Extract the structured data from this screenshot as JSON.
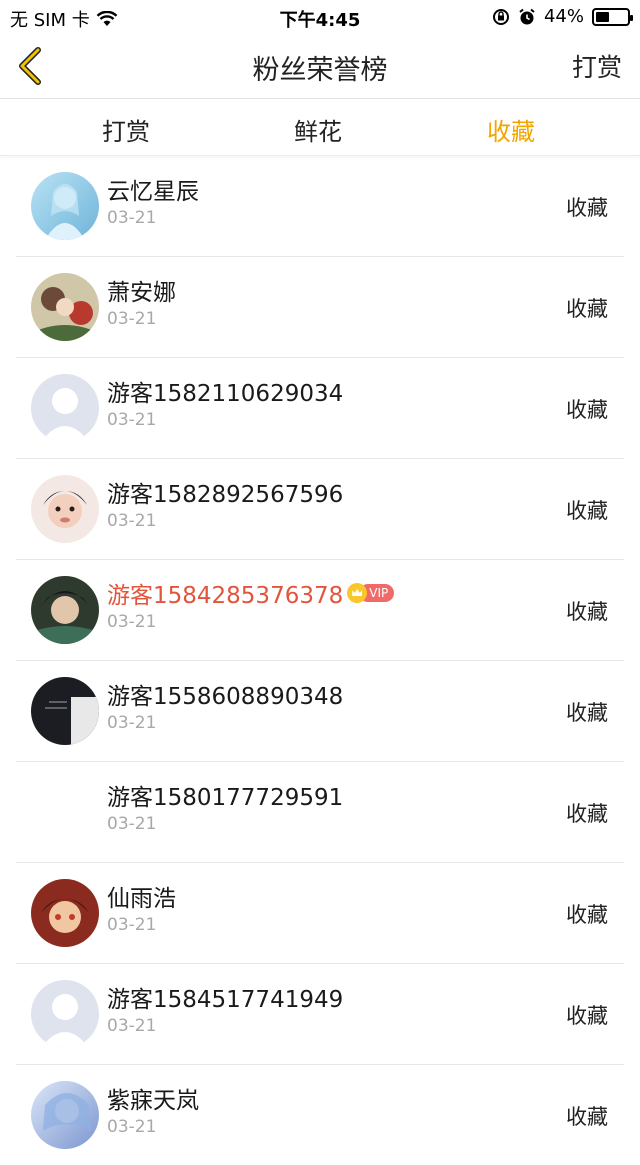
{
  "status_bar": {
    "carrier": "无 SIM 卡",
    "time": "下午4:45",
    "battery": "44%",
    "battery_level": 0.44
  },
  "nav": {
    "title": "粉丝荣誉榜",
    "action": "打赏"
  },
  "tabs": [
    {
      "label": "打赏",
      "active": false
    },
    {
      "label": "鲜花",
      "active": false
    },
    {
      "label": "收藏",
      "active": true
    }
  ],
  "colors": {
    "accent": "#f2a400",
    "vip_name": "#e1553d",
    "date": "#a8a8a8"
  },
  "rows": [
    {
      "name": "云忆星辰",
      "date": "03-21",
      "type": "收藏",
      "vip": false,
      "vip_tag": ""
    },
    {
      "name": "萧安娜",
      "date": "03-21",
      "type": "收藏",
      "vip": false,
      "vip_tag": ""
    },
    {
      "name": "游客1582110629034",
      "date": "03-21",
      "type": "收藏",
      "vip": false,
      "vip_tag": ""
    },
    {
      "name": "游客1582892567596",
      "date": "03-21",
      "type": "收藏",
      "vip": false,
      "vip_tag": ""
    },
    {
      "name": "游客1584285376378",
      "date": "03-21",
      "type": "收藏",
      "vip": true,
      "vip_tag": "VIP"
    },
    {
      "name": "游客1558608890348",
      "date": "03-21",
      "type": "收藏",
      "vip": false,
      "vip_tag": ""
    },
    {
      "name": "游客1580177729591",
      "date": "03-21",
      "type": "收藏",
      "vip": false,
      "vip_tag": ""
    },
    {
      "name": "仙雨浩",
      "date": "03-21",
      "type": "收藏",
      "vip": false,
      "vip_tag": ""
    },
    {
      "name": "游客1584517741949",
      "date": "03-21",
      "type": "收藏",
      "vip": false,
      "vip_tag": ""
    },
    {
      "name": "紫寐天岚",
      "date": "03-21",
      "type": "收藏",
      "vip": false,
      "vip_tag": ""
    }
  ]
}
